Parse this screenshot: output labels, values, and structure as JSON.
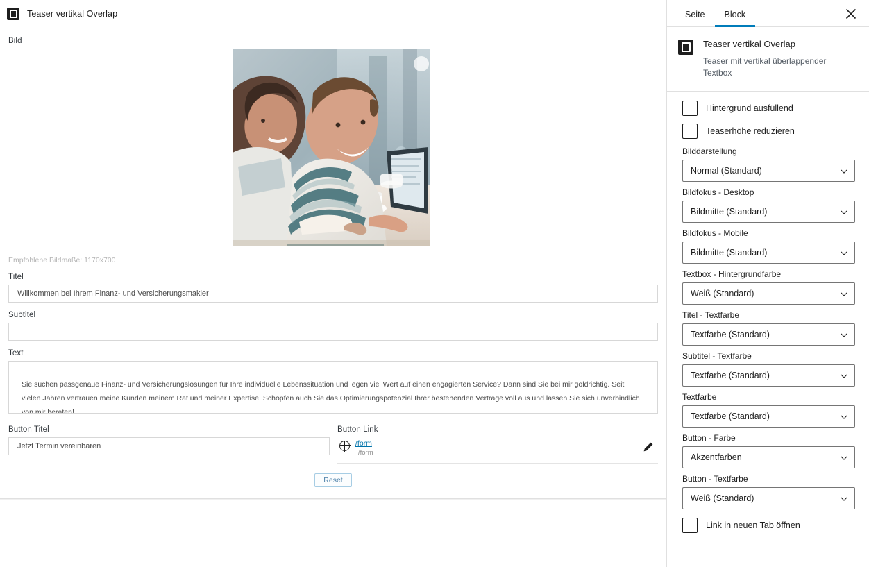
{
  "editor": {
    "block_toolbar": {
      "icon": "block-teaser-icon",
      "title": "Teaser vertikal Overlap"
    },
    "fields": {
      "image_label": "Bild",
      "image_hint": "Empfohlene Bildmaße: 1170x700",
      "title_label": "Titel",
      "title_value": "Willkommen bei Ihrem Finanz- und Versicherungsmakler",
      "subtitle_label": "Subtitel",
      "subtitle_value": "",
      "text_label": "Text",
      "text_value": "Sie suchen passgenaue Finanz- und Versicherungslösungen für Ihre individuelle Lebenssituation und legen viel Wert auf einen engagierten Service? Dann sind Sie bei mir goldrichtig. Seit vielen Jahren vertrauen meine Kunden meinem Rat und meiner Expertise. Schöpfen auch Sie das Optimierungspotenzial Ihrer bestehenden Verträge voll aus und lassen Sie sich unverbindlich von mir beraten!",
      "button_title_label": "Button Titel",
      "button_title_value": "Jetzt Termin vereinbaren",
      "button_link_label": "Button Link",
      "button_link_text": "/form",
      "button_link_sub": "/form"
    },
    "reset_label": "Reset"
  },
  "sidebar": {
    "tabs": [
      {
        "label": "Seite",
        "active": false
      },
      {
        "label": "Block",
        "active": true
      }
    ],
    "close_label": "×",
    "block": {
      "title": "Teaser vertikal Overlap",
      "description": "Teaser mit vertikal überlappender Textbox"
    },
    "checkboxes": [
      {
        "label": "Hintergrund ausfüllend",
        "checked": false
      },
      {
        "label": "Teaserhöhe reduzieren",
        "checked": false
      }
    ],
    "selects": [
      {
        "label": "Bilddarstellung",
        "value": "Normal (Standard)"
      },
      {
        "label": "Bildfokus - Desktop",
        "value": "Bildmitte (Standard)"
      },
      {
        "label": "Bildfokus - Mobile",
        "value": "Bildmitte (Standard)"
      },
      {
        "label": "Textbox - Hintergrundfarbe",
        "value": "Weiß (Standard)"
      },
      {
        "label": "Titel - Textfarbe",
        "value": "Textfarbe (Standard)"
      },
      {
        "label": "Subtitel - Textfarbe",
        "value": "Textfarbe (Standard)"
      },
      {
        "label": "Textfarbe",
        "value": "Textfarbe (Standard)"
      },
      {
        "label": "Button - Farbe",
        "value": "Akzentfarben"
      },
      {
        "label": "Button - Textfarbe",
        "value": "Weiß (Standard)"
      }
    ],
    "checkbox_bottom": {
      "label": "Link in neuen Tab öffnen",
      "checked": false
    }
  },
  "colors": {
    "accent": "#007cba",
    "link": "#0073aa",
    "text": "#1e1e1e",
    "border": "#e0e0e0",
    "reset_border": "#a7cde4"
  }
}
